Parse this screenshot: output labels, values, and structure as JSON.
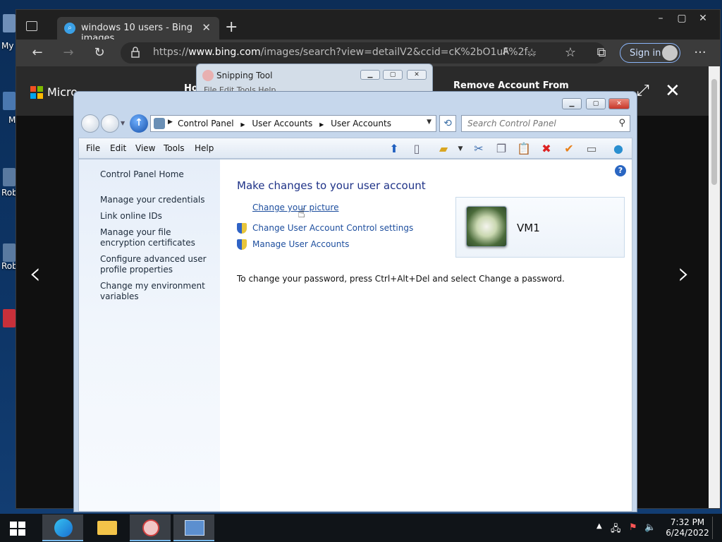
{
  "desktop": {
    "labels": [
      "My",
      "M",
      "Rob",
      "Rob"
    ]
  },
  "browser": {
    "tab_title": "windows 10 users - Bing images",
    "tab_close": "✕",
    "new_tab": "+",
    "window_controls": [
      "–",
      "▢",
      "✕"
    ],
    "url_host": "https://www.bing.com",
    "url_rest": "/images/search?view=detailV2&ccid=cK%2bO1uF%2f...",
    "url_host_bold": "www.bing.com",
    "url_prefix": "https://",
    "read_aloud": "A",
    "sign_in": "Sign in",
    "more": "···"
  },
  "bing": {
    "brand": "Microsoft Bing",
    "partial_brand": "Micro",
    "home_partial": "Ho",
    "remove_account": "Remove Account From",
    "prev_arrow": "‹",
    "next_arrow": "›",
    "close": "✕",
    "expand": "⤢"
  },
  "snipping_tool": {
    "title": "Snipping Tool",
    "menu": "File    Edit    Tools    Help"
  },
  "control_panel": {
    "breadcrumb": [
      "Control Panel",
      "User Accounts",
      "User Accounts"
    ],
    "search_placeholder": "Search Control Panel",
    "menu": [
      "File",
      "Edit",
      "View",
      "Tools",
      "Help"
    ],
    "left_nav": [
      "Control Panel Home",
      "Manage your credentials",
      "Link online IDs",
      "Manage your file encryption certificates",
      "Configure advanced user profile properties",
      "Change my environment variables"
    ],
    "heading": "Make changes to your user account",
    "tasks": {
      "change_picture": "Change your picture",
      "uac_settings": "Change User Account Control settings",
      "manage_accounts": "Manage User Accounts"
    },
    "password_note": "To change your password, press Ctrl+Alt+Del and select Change a password.",
    "user_name": "VM1",
    "help": "?"
  },
  "taskbar": {
    "time": "7:32 PM",
    "date": "6/24/2022"
  }
}
